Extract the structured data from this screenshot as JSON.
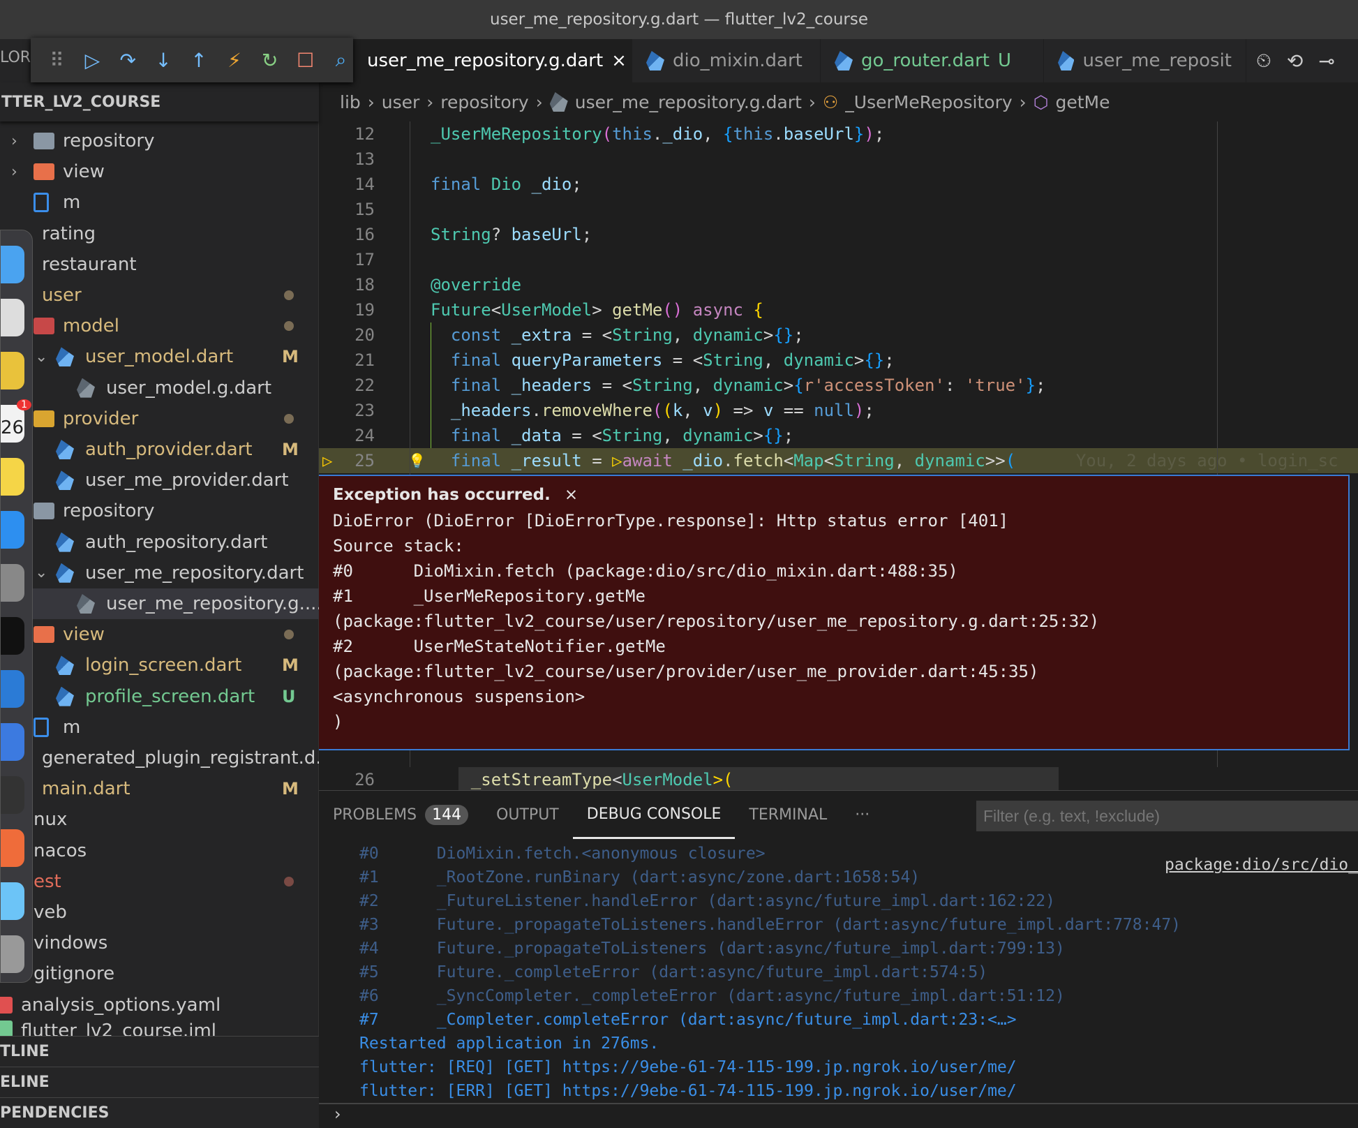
{
  "window_title": "user_me_repository.g.dart — flutter_lv2_course",
  "explorer_label_fragment": "LOR",
  "debug_toolbar": [
    {
      "icon": "drag-handle-icon",
      "glyph": "⠿",
      "color": "#888"
    },
    {
      "icon": "continue-icon",
      "glyph": "▷",
      "color": "#75beff"
    },
    {
      "icon": "step-over-icon",
      "glyph": "↷",
      "color": "#75beff"
    },
    {
      "icon": "step-into-icon",
      "glyph": "↓",
      "color": "#75beff"
    },
    {
      "icon": "step-out-icon",
      "glyph": "↑",
      "color": "#75beff"
    },
    {
      "icon": "hot-reload-icon",
      "glyph": "⚡",
      "color": "#f0a732"
    },
    {
      "icon": "restart-icon",
      "glyph": "↻",
      "color": "#89d185"
    },
    {
      "icon": "stop-icon",
      "glyph": "☐",
      "color": "#f48771"
    },
    {
      "icon": "devtools-icon",
      "glyph": "⌕",
      "color": "#4fb3ff"
    }
  ],
  "tabs": [
    {
      "label": "user_me_repository.g.dart",
      "active": true,
      "close": "×",
      "grey": true
    },
    {
      "label": "dio_mixin.dart",
      "active": false
    },
    {
      "label": "go_router.dart",
      "active": false,
      "status": "U",
      "color": "#73c991"
    },
    {
      "label": "user_me_reposit",
      "active": false
    }
  ],
  "tab_actions": [
    "⏲",
    "⟲",
    "⊸"
  ],
  "breadcrumb": {
    "items": [
      "lib",
      "user",
      "repository",
      "user_me_repository.g.dart",
      "_UserMeRepository",
      "getMe"
    ],
    "sep": "›"
  },
  "explorer": {
    "project": "TTER_LV2_COURSE",
    "rows": [
      {
        "label": "repository",
        "chev": "›",
        "indent": 1,
        "icon": "folder",
        "iconColor": "#8a97a4"
      },
      {
        "label": "view",
        "chev": "›",
        "indent": 1,
        "icon": "folder-view",
        "iconColor": "#e8704a"
      },
      {
        "label": "m",
        "indent": 1,
        "icon": "file",
        "iconColor": "#3b8eea"
      },
      {
        "label": "rating",
        "indent": 0
      },
      {
        "label": "restaurant",
        "indent": 0
      },
      {
        "label": "user",
        "indent": 0,
        "color": "#d7ba7d",
        "dot": true
      },
      {
        "label": "model",
        "indent": 1,
        "icon": "folder-model",
        "iconColor": "#c74848",
        "color": "#d7ba7d",
        "dot": true
      },
      {
        "label": "user_model.dart",
        "chev": "⌄",
        "indent": 2,
        "icon": "dart",
        "color": "#d7ba7d",
        "badge": "M"
      },
      {
        "label": "user_model.g.dart",
        "indent": 3,
        "icon": "dart-grey"
      },
      {
        "label": "provider",
        "indent": 1,
        "icon": "folder-provider",
        "iconColor": "#d9a530",
        "color": "#d7ba7d",
        "dot": true
      },
      {
        "label": "auth_provider.dart",
        "indent": 2,
        "icon": "dart",
        "color": "#d7ba7d",
        "badge": "M"
      },
      {
        "label": "user_me_provider.dart",
        "indent": 2,
        "icon": "dart"
      },
      {
        "label": "repository",
        "indent": 1,
        "icon": "folder-open",
        "iconColor": "#8a97a4"
      },
      {
        "label": "auth_repository.dart",
        "indent": 2,
        "icon": "dart"
      },
      {
        "label": "user_me_repository.dart",
        "chev": "⌄",
        "indent": 2,
        "icon": "dart"
      },
      {
        "label": "user_me_repository.g....",
        "indent": 3,
        "icon": "dart-grey",
        "selected": true
      },
      {
        "label": "view",
        "indent": 1,
        "icon": "folder-view",
        "iconColor": "#e8704a",
        "color": "#d7ba7d",
        "dot": true
      },
      {
        "label": "login_screen.dart",
        "indent": 2,
        "icon": "dart",
        "color": "#d7ba7d",
        "badge": "M"
      },
      {
        "label": "profile_screen.dart",
        "indent": 2,
        "icon": "dart",
        "color": "#73c991",
        "badge": "U"
      },
      {
        "label": "m",
        "indent": 1,
        "icon": "file",
        "iconColor": "#3b8eea"
      },
      {
        "label": "generated_plugin_registrant.d...",
        "indent": 0
      },
      {
        "label": "main.dart",
        "indent": 0,
        "color": "#d7ba7d",
        "badge": "M"
      },
      {
        "label": "nux",
        "indent": -1
      },
      {
        "label": "nacos",
        "indent": -1
      },
      {
        "label": "est",
        "indent": -1,
        "color": "#e06c5a",
        "dot": true,
        "dotColor": "#7a4a44"
      },
      {
        "label": "veb",
        "indent": -1
      },
      {
        "label": "vindows",
        "indent": -1
      },
      {
        "label": "gitignore",
        "indent": -1
      },
      {
        "label": "analysis_options.yaml",
        "indent": -2,
        "icon": "yaml",
        "iconColor": "#e05050"
      },
      {
        "label": "flutter_lv2_course.iml",
        "indent": -2,
        "icon": "iml",
        "iconColor": "#73c991"
      }
    ],
    "sections": [
      "TLINE",
      "ELINE",
      "PENDENCIES"
    ]
  },
  "dock": [
    {
      "name": "finder",
      "color": "#4aa3f0"
    },
    {
      "name": "launchpad",
      "color": "#ddd"
    },
    {
      "name": "chrome",
      "color": "#e9c23b"
    },
    {
      "name": "calendar",
      "color": "#f2f2f2",
      "badge": "1",
      "text": "26"
    },
    {
      "name": "notes",
      "color": "#f5d547"
    },
    {
      "name": "app-store",
      "color": "#2d8ff0"
    },
    {
      "name": "system-settings",
      "color": "#888"
    },
    {
      "name": "terminal",
      "color": "#111"
    },
    {
      "name": "vscode",
      "color": "#2b7bd6"
    },
    {
      "name": "xcode",
      "color": "#3c7ae0"
    },
    {
      "name": "keychain",
      "color": "#333"
    },
    {
      "name": "postman",
      "color": "#ef6c3a"
    },
    {
      "name": "folder",
      "color": "#6cc4f7"
    },
    {
      "name": "trash",
      "color": "#999"
    }
  ],
  "code": [
    {
      "n": "12",
      "segs": [
        [
          "_UserMeRepository",
          "t"
        ],
        [
          "(",
          "pk"
        ],
        [
          "this",
          "k"
        ],
        [
          ".",
          "p"
        ],
        [
          "_dio",
          "v"
        ],
        [
          ", ",
          "p"
        ],
        [
          "{",
          "bb"
        ],
        [
          "this",
          "k"
        ],
        [
          ".",
          "p"
        ],
        [
          "baseUrl",
          "v"
        ],
        [
          "}",
          "bb"
        ],
        [
          ")",
          "pk"
        ],
        [
          ";",
          "p"
        ]
      ]
    },
    {
      "n": "13",
      "segs": []
    },
    {
      "n": "14",
      "segs": [
        [
          "final ",
          "k"
        ],
        [
          "Dio ",
          "t"
        ],
        [
          "_dio",
          "v"
        ],
        [
          ";",
          "p"
        ]
      ]
    },
    {
      "n": "15",
      "segs": []
    },
    {
      "n": "16",
      "segs": [
        [
          "String",
          "t"
        ],
        [
          "? ",
          "p"
        ],
        [
          "baseUrl",
          "v"
        ],
        [
          ";",
          "p"
        ]
      ]
    },
    {
      "n": "17",
      "segs": []
    },
    {
      "n": "18",
      "segs": [
        [
          "@override",
          "t"
        ]
      ]
    },
    {
      "n": "19",
      "segs": [
        [
          "Future",
          "t"
        ],
        [
          "<",
          "p"
        ],
        [
          "UserModel",
          "t"
        ],
        [
          "> ",
          "p"
        ],
        [
          "getMe",
          "f"
        ],
        [
          "()",
          "pk"
        ],
        [
          " async ",
          "pu"
        ],
        [
          "{",
          "yb"
        ]
      ]
    },
    {
      "n": "20",
      "segs": [
        [
          "  const ",
          "k"
        ],
        [
          "_extra",
          "v"
        ],
        [
          " = <",
          "p"
        ],
        [
          "String",
          "t"
        ],
        [
          ", ",
          "p"
        ],
        [
          "dynamic",
          "t"
        ],
        [
          ">",
          "p"
        ],
        [
          "{}",
          "bb"
        ],
        [
          ";",
          "p"
        ]
      ]
    },
    {
      "n": "21",
      "segs": [
        [
          "  final ",
          "k"
        ],
        [
          "queryParameters",
          "v"
        ],
        [
          " = <",
          "p"
        ],
        [
          "String",
          "t"
        ],
        [
          ", ",
          "p"
        ],
        [
          "dynamic",
          "t"
        ],
        [
          ">",
          "p"
        ],
        [
          "{}",
          "bb"
        ],
        [
          ";",
          "p"
        ]
      ]
    },
    {
      "n": "22",
      "segs": [
        [
          "  final ",
          "k"
        ],
        [
          "_headers",
          "v"
        ],
        [
          " = <",
          "p"
        ],
        [
          "String",
          "t"
        ],
        [
          ", ",
          "p"
        ],
        [
          "dynamic",
          "t"
        ],
        [
          ">",
          "p"
        ],
        [
          "{",
          "bb"
        ],
        [
          "r'accessToken'",
          "s"
        ],
        [
          ": ",
          "p"
        ],
        [
          "'true'",
          "s"
        ],
        [
          "}",
          "bb"
        ],
        [
          ";",
          "p"
        ]
      ]
    },
    {
      "n": "23",
      "segs": [
        [
          "  _headers",
          "v"
        ],
        [
          ".",
          "p"
        ],
        [
          "removeWhere",
          "f"
        ],
        [
          "(",
          "pk"
        ],
        [
          "(",
          "yb"
        ],
        [
          "k",
          "v"
        ],
        [
          ", ",
          "p"
        ],
        [
          "v",
          "v"
        ],
        [
          ")",
          "yb"
        ],
        [
          " => ",
          "p"
        ],
        [
          "v",
          "v"
        ],
        [
          " == ",
          "p"
        ],
        [
          "null",
          "k"
        ],
        [
          ")",
          "pk"
        ],
        [
          ";",
          "p"
        ]
      ]
    },
    {
      "n": "24",
      "segs": [
        [
          "  final ",
          "k"
        ],
        [
          "_data",
          "v"
        ],
        [
          " = <",
          "p"
        ],
        [
          "String",
          "t"
        ],
        [
          ", ",
          "p"
        ],
        [
          "dynamic",
          "t"
        ],
        [
          ">",
          "p"
        ],
        [
          "{}",
          "bb"
        ],
        [
          ";",
          "p"
        ]
      ]
    },
    {
      "n": "25",
      "highlight": true,
      "segs": [
        [
          "  final ",
          "k"
        ],
        [
          "_result",
          "v"
        ],
        [
          " = ",
          "p"
        ],
        [
          "▷",
          "yb"
        ],
        [
          "await ",
          "pu"
        ],
        [
          "_dio",
          "v"
        ],
        [
          ".",
          "p"
        ],
        [
          "fetch",
          "f"
        ],
        [
          "<",
          "p"
        ],
        [
          "Map",
          "t"
        ],
        [
          "<",
          "p"
        ],
        [
          "String",
          "t"
        ],
        [
          ", ",
          "p"
        ],
        [
          "dynamic",
          "t"
        ],
        [
          ">>",
          "p"
        ],
        [
          "(",
          "bb"
        ],
        [
          "      You, 2 days ago • login_sc",
          "blame"
        ]
      ]
    }
  ],
  "code_after": {
    "n": "26",
    "segs": [
      [
        "    _setStreamType",
        "f"
      ],
      [
        "<",
        "p"
      ],
      [
        "UserModel",
        "t"
      ],
      [
        ">(",
        "yb"
      ]
    ]
  },
  "exception": {
    "title": "Exception has occurred.",
    "close": "×",
    "lines": [
      "DioError (DioError [DioErrorType.response]: Http status error [401]",
      "Source stack:",
      "#0      DioMixin.fetch (package:dio/src/dio_mixin.dart:488:35)",
      "#1      _UserMeRepository.getMe",
      "(package:flutter_lv2_course/user/repository/user_me_repository.g.dart:25:32)",
      "#2      UserMeStateNotifier.getMe",
      "(package:flutter_lv2_course/user/provider/user_me_provider.dart:45:35)",
      "<asynchronous suspension>",
      ")"
    ]
  },
  "panel": {
    "tabs": [
      {
        "label": "PROBLEMS",
        "count": "144"
      },
      {
        "label": "OUTPUT"
      },
      {
        "label": "DEBUG CONSOLE",
        "active": true
      },
      {
        "label": "TERMINAL"
      },
      {
        "label": "···"
      }
    ],
    "filter_placeholder": "Filter (e.g. text, !exclude)",
    "link": "package:dio/src/dio_",
    "lines": [
      {
        "t": "#0      DioMixin.fetch.<anonymous closure>"
      },
      {
        "t": "#1      _RootZone.runBinary (dart:async/zone.dart:1658:54)"
      },
      {
        "t": "#2      _FutureListener.handleError (dart:async/future_impl.dart:162:22)"
      },
      {
        "t": "#3      Future._propagateToListeners.handleError (dart:async/future_impl.dart:778:47)"
      },
      {
        "t": "#4      Future._propagateToListeners (dart:async/future_impl.dart:799:13)"
      },
      {
        "t": "#5      Future._completeError (dart:async/future_impl.dart:574:5)"
      },
      {
        "t": "#6      _SyncCompleter._completeError (dart:async/future_impl.dart:51:12)"
      },
      {
        "t": "#7      _Completer.completeError (dart:async/future_impl.dart:23:<…>",
        "bright": true
      },
      {
        "t": "Restarted application in 276ms.",
        "bright": true
      },
      {
        "t": "flutter: [REQ] [GET] https://9ebe-61-74-115-199.jp.ngrok.io/user/me/",
        "bright": true
      },
      {
        "t": "flutter: [ERR] [GET] https://9ebe-61-74-115-199.jp.ngrok.io/user/me/",
        "bright": true
      }
    ],
    "prompt": "›"
  },
  "colors": {
    "k": "#569cd6",
    "t": "#4ec9b0",
    "f": "#dcdcaa",
    "v": "#9cdcfe",
    "s": "#ce9178",
    "pu": "#c586c0",
    "p": "#d4d4d4",
    "pk": "#da70d6",
    "yb": "#ffd700",
    "bb": "#179fff",
    "blame": "#5c5c45"
  }
}
